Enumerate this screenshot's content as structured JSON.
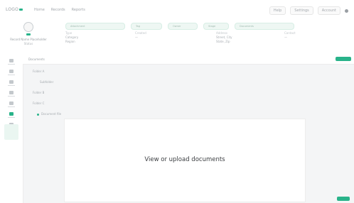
{
  "app": {
    "logo": "LOGO"
  },
  "topnav": [
    "Home",
    "Records",
    "Reports"
  ],
  "topright": [
    "Help",
    "Settings",
    "Account"
  ],
  "record": {
    "name": "Record Name Placeholder",
    "sub": "Status"
  },
  "chips": [
    "Attachment",
    "Tag",
    "Owner",
    "Stage",
    "Documents"
  ],
  "fields": [
    [
      "Type",
      "Category",
      "Region"
    ],
    [
      "Created",
      "—"
    ],
    [
      "Address",
      "Street, City",
      "State, Zip"
    ],
    [
      "Contact",
      "—"
    ]
  ],
  "sidebar": [
    "Home",
    "Info",
    "Tasks",
    "Notes",
    "Docs",
    "Activity",
    "More"
  ],
  "main": {
    "title": "Documents",
    "tree": [
      "Folder A",
      "Subfolder",
      "Folder B",
      "Folder C",
      "Document file"
    ]
  },
  "viewer": {
    "message": "View or upload documents"
  },
  "colors": {
    "accent": "#29b38a"
  }
}
